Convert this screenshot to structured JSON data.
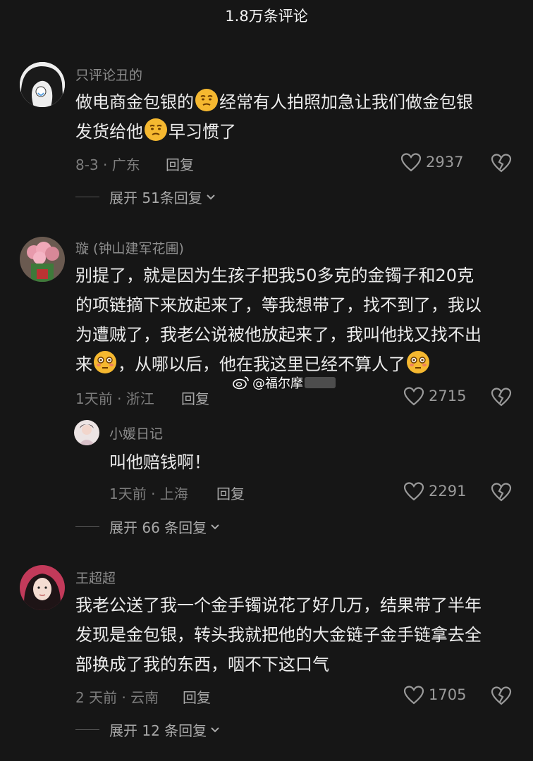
{
  "header": {
    "title": "1.8万条评论"
  },
  "comments": [
    {
      "username": "只评论丑的",
      "lines": [
        "做电商金包银的",
        "经常有人拍照加急让我们做金包银",
        "发货给他",
        "早习惯了"
      ],
      "emoji": "smirk-emoji",
      "meta": "8-3 · 广东",
      "reply_label": "回复",
      "likes": "2937",
      "expand_label": "展开 51条回复"
    },
    {
      "username": "璇 (钟山建军花圃)",
      "lines": [
        "别提了，就是因为生孩子把我50多克的金镯子和20克",
        "的项链摘下来放起来了，等我想带了，找不到了，我以",
        "为遭贼了，我老公说被他放起来了，我叫他找又找不出",
        "来",
        "，从哪以后，他在我这里已经不算人了"
      ],
      "emoji": "flushed-emoji",
      "meta": "1天前 · 浙江",
      "reply_label": "回复",
      "likes": "2715",
      "sub_reply": {
        "username": "小媛日记",
        "text": "叫他赔钱啊！",
        "meta": "1天前 · 上海",
        "reply_label": "回复",
        "likes": "2291"
      },
      "expand_label": "展开 66 条回复"
    },
    {
      "username": "王超超",
      "lines": [
        "我老公送了我一个金手镯说花了好几万，结果带了半年",
        "发现是金包银，转头我就把他的大金链子金手链拿去全",
        "部换成了我的东西，咽不下这口气"
      ],
      "meta": "2 天前 · 云南",
      "reply_label": "回复",
      "likes": "1705",
      "expand_label": "展开 12 条回复"
    }
  ],
  "watermark": {
    "text": "@福尔摩"
  },
  "colors": {
    "background": "#161616",
    "text": "#ececec",
    "secondary": "#8d8d8d",
    "emoji": "#f5b830"
  }
}
